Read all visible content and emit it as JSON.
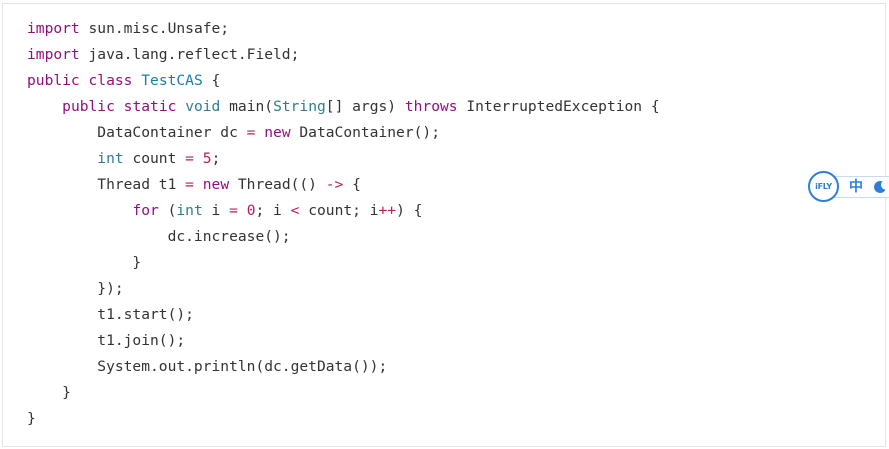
{
  "code": {
    "lines": [
      [
        {
          "t": "import",
          "k": "kw"
        },
        {
          "t": " sun.misc.Unsafe;"
        }
      ],
      [
        {
          "t": "import",
          "k": "kw"
        },
        {
          "t": " java.lang.reflect.Field;"
        }
      ],
      [
        {
          "t": "public",
          "k": "kw"
        },
        {
          "t": " "
        },
        {
          "t": "class",
          "k": "kw"
        },
        {
          "t": " "
        },
        {
          "t": "TestCAS",
          "k": "cls"
        },
        {
          "t": " {"
        }
      ],
      [
        {
          "t": "    "
        },
        {
          "t": "public",
          "k": "kw"
        },
        {
          "t": " "
        },
        {
          "t": "static",
          "k": "kw"
        },
        {
          "t": " "
        },
        {
          "t": "void",
          "k": "ty"
        },
        {
          "t": " main("
        },
        {
          "t": "String",
          "k": "ty"
        },
        {
          "t": "[] args) "
        },
        {
          "t": "throws",
          "k": "kw"
        },
        {
          "t": " InterruptedException {"
        }
      ],
      [
        {
          "t": "        DataContainer dc "
        },
        {
          "t": "=",
          "k": "op"
        },
        {
          "t": " "
        },
        {
          "t": "new",
          "k": "kw"
        },
        {
          "t": " DataContainer();"
        }
      ],
      [
        {
          "t": "        "
        },
        {
          "t": "int",
          "k": "ty"
        },
        {
          "t": " count "
        },
        {
          "t": "=",
          "k": "op"
        },
        {
          "t": " "
        },
        {
          "t": "5",
          "k": "num"
        },
        {
          "t": ";"
        }
      ],
      [
        {
          "t": "        Thread t1 "
        },
        {
          "t": "=",
          "k": "op"
        },
        {
          "t": " "
        },
        {
          "t": "new",
          "k": "kw"
        },
        {
          "t": " Thread(() "
        },
        {
          "t": "->",
          "k": "op"
        },
        {
          "t": " {"
        }
      ],
      [
        {
          "t": "            "
        },
        {
          "t": "for",
          "k": "kw"
        },
        {
          "t": " ("
        },
        {
          "t": "int",
          "k": "ty"
        },
        {
          "t": " i "
        },
        {
          "t": "=",
          "k": "op"
        },
        {
          "t": " "
        },
        {
          "t": "0",
          "k": "num"
        },
        {
          "t": "; i "
        },
        {
          "t": "<",
          "k": "op"
        },
        {
          "t": " count; i"
        },
        {
          "t": "++",
          "k": "op"
        },
        {
          "t": ") {"
        }
      ],
      [
        {
          "t": "                dc.increase();"
        }
      ],
      [
        {
          "t": "            }"
        }
      ],
      [
        {
          "t": "        });"
        }
      ],
      [
        {
          "t": "        t1.start();"
        }
      ],
      [
        {
          "t": "        t1.join();"
        }
      ],
      [
        {
          "t": "        System.out.println(dc.getData());"
        }
      ],
      [
        {
          "t": "    }"
        }
      ],
      [
        {
          "t": "}"
        }
      ]
    ]
  },
  "ime_widget": {
    "logo_text": "iFLY",
    "language_label": "中",
    "mode_icon": "moon-icon",
    "accent_color": "#2d7fd9"
  },
  "syntax_colors": {
    "keyword": "#930f80",
    "type": "#2f7d8c",
    "class_name": "#1a7fa7",
    "operator": "#c2185b",
    "default": "#333333"
  }
}
